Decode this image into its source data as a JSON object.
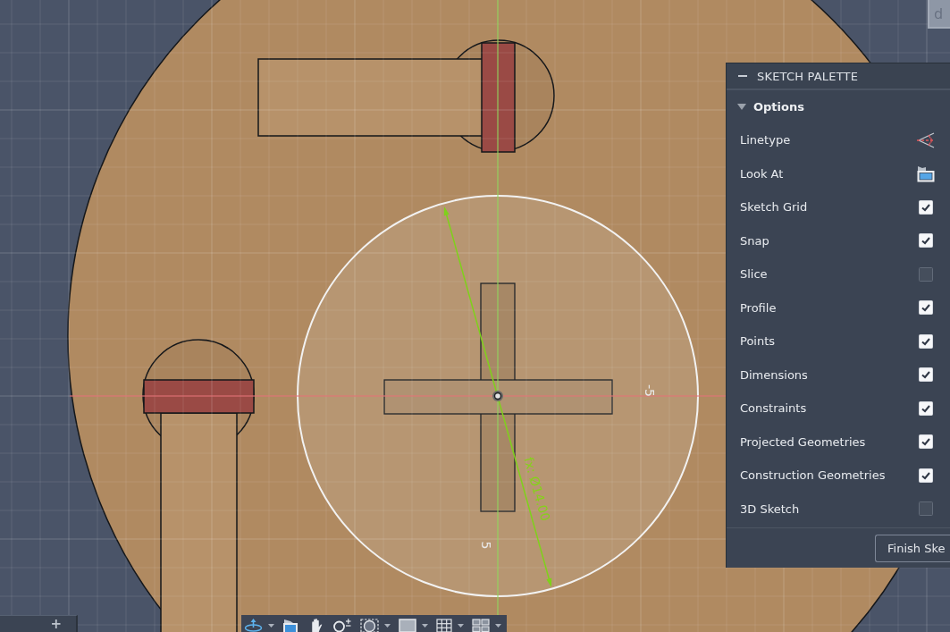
{
  "corner_tab": {
    "label": "d"
  },
  "viewport": {
    "dimension_label": "fx: Ø14.00",
    "axis_labels": [
      {
        "kind": "x",
        "text": "-5"
      },
      {
        "kind": "y",
        "text": "5"
      }
    ]
  },
  "sketch_palette": {
    "title": "SKETCH PALETTE",
    "section": {
      "label": "Options",
      "expanded": true
    },
    "options": [
      {
        "kind": "linetype",
        "label": "Linetype"
      },
      {
        "kind": "look_at",
        "label": "Look At"
      },
      {
        "kind": "checkbox",
        "label": "Sketch Grid",
        "checked": true
      },
      {
        "kind": "checkbox",
        "label": "Snap",
        "checked": true
      },
      {
        "kind": "checkbox",
        "label": "Slice",
        "checked": false
      },
      {
        "kind": "checkbox",
        "label": "Profile",
        "checked": true
      },
      {
        "kind": "checkbox",
        "label": "Points",
        "checked": true
      },
      {
        "kind": "checkbox",
        "label": "Dimensions",
        "checked": true
      },
      {
        "kind": "checkbox",
        "label": "Constraints",
        "checked": true
      },
      {
        "kind": "checkbox",
        "label": "Projected Geometries",
        "checked": true
      },
      {
        "kind": "checkbox",
        "label": "Construction Geometries",
        "checked": true
      },
      {
        "kind": "checkbox",
        "label": "3D Sketch",
        "checked": false
      }
    ],
    "finish_button": "Finish Ske"
  },
  "browser_panel": {
    "add_button": "+"
  },
  "navigation_bar": {
    "tools": [
      {
        "kind": "orbit",
        "dropdown": true
      },
      {
        "kind": "look_at",
        "dropdown": false
      },
      {
        "kind": "pan",
        "dropdown": false
      },
      {
        "kind": "zoom",
        "dropdown": false
      },
      {
        "kind": "fit",
        "dropdown": true
      },
      {
        "kind": "display",
        "dropdown": true
      },
      {
        "kind": "grid",
        "dropdown": true
      },
      {
        "kind": "viewports",
        "dropdown": true
      }
    ]
  }
}
